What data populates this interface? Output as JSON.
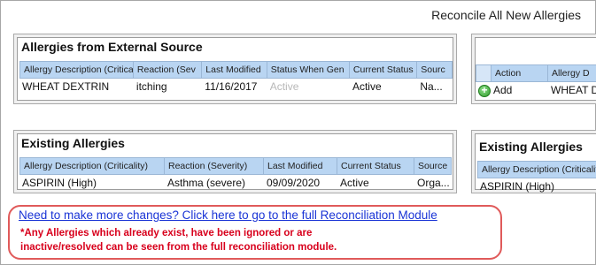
{
  "window": {
    "title": "Reconcile All New Allergies"
  },
  "external_panel": {
    "title": "Allergies from External Source",
    "columns": [
      "Allergy Description (Critica",
      "Reaction (Sev",
      "Last Modified",
      "Status When Gen",
      "Current Status",
      "Sourc"
    ],
    "rows": [
      [
        "WHEAT DEXTRIN",
        "itching",
        "11/16/2017",
        "Active",
        "Active",
        "Na..."
      ]
    ]
  },
  "existing_panel": {
    "title": "Existing Allergies",
    "columns": [
      "Allergy Description (Criticality)",
      "Reaction (Severity)",
      "Last Modified",
      "Current Status",
      "Source"
    ],
    "rows": [
      [
        "ASPIRIN (High)",
        "Asthma (severe)",
        "09/09/2020",
        "Active",
        "Orga..."
      ]
    ]
  },
  "right_action_panel": {
    "columns": [
      "Action",
      "Allergy D"
    ],
    "rows": [
      {
        "icon": "add-circle-icon",
        "action": "Add",
        "allergy": "WHEAT D"
      }
    ]
  },
  "right_existing_panel": {
    "title": "Existing Allergies",
    "columns": [
      "Allergy Description (Criticality)"
    ],
    "rows": [
      [
        "ASPIRIN (High)"
      ]
    ]
  },
  "footer": {
    "link_text": "Need to make more changes?  Click here to go to the full Reconciliation Module",
    "note_line1": "*Any Allergies which already exist, have been ignored or are",
    "note_line2": " inactive/resolved can be seen from the full reconciliation module."
  },
  "colors": {
    "header_bg": "#b9d5f2",
    "link": "#1a34d6",
    "note": "#d8001c",
    "highlight_border": "#e05a5a"
  }
}
